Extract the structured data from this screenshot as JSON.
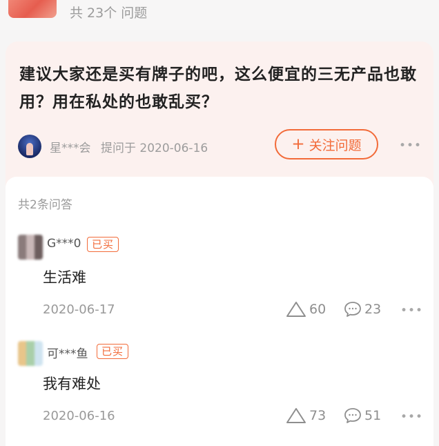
{
  "header": {
    "question_count": "共 23个 问题"
  },
  "question": {
    "title": "建议大家还是买有牌子的吧，这么便宜的三无产品也敢用？用在私处的也敢乱买？",
    "asker_name": "星***会",
    "asked_at": "提问于 2020-06-16",
    "follow_button": {
      "plus": "+",
      "label": "关注问题"
    },
    "more": "•••"
  },
  "answers_section": {
    "count_label": "共2条问答",
    "items": [
      {
        "user": "G***0",
        "badge": "已买",
        "text": "生活难",
        "date": "2020-06-17",
        "likes": "60",
        "comments": "23",
        "more": "•••"
      },
      {
        "user": "可***鱼",
        "badge": "已买",
        "text": "我有难处",
        "date": "2020-06-16",
        "likes": "73",
        "comments": "51",
        "more": "•••"
      }
    ]
  },
  "colors": {
    "accent": "#f26a38",
    "question_bg": "#fcf1ef",
    "muted_text": "#999999"
  }
}
